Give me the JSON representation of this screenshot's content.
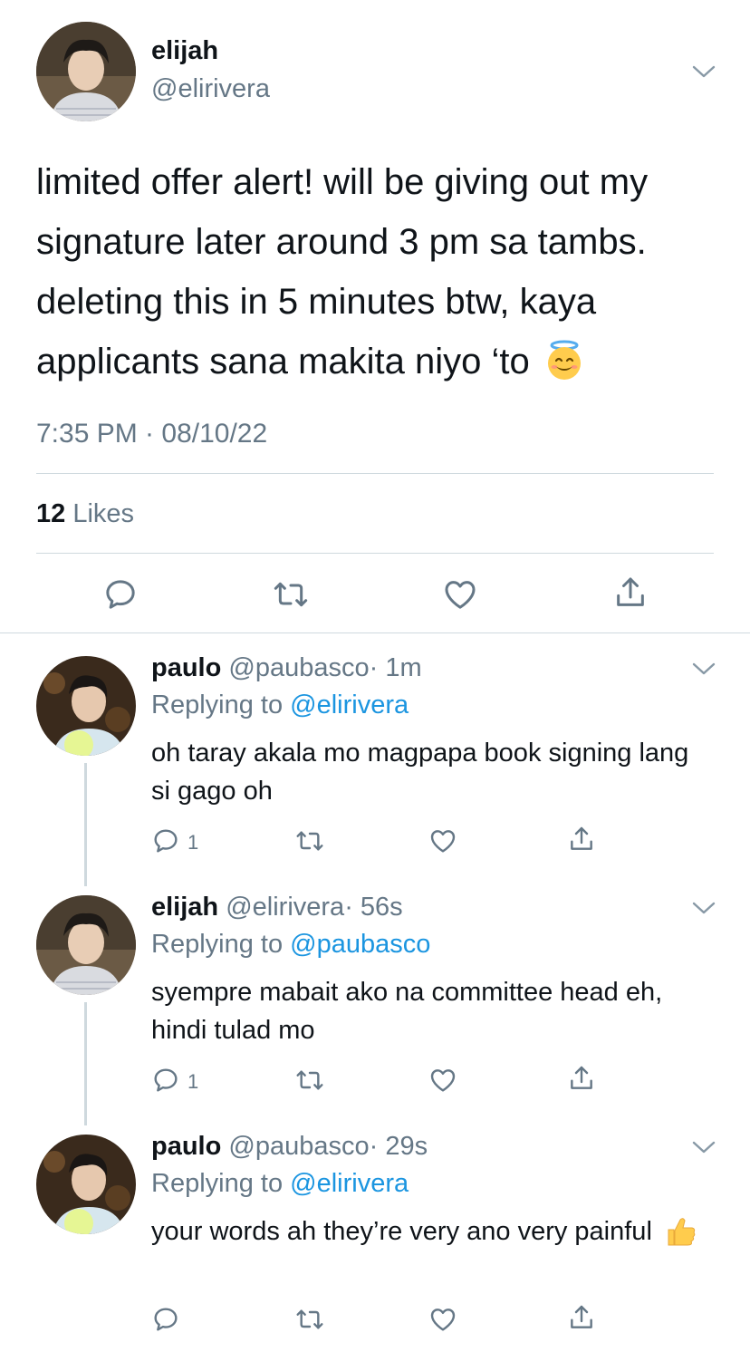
{
  "main_tweet": {
    "name": "elijah",
    "handle": "@elirivera",
    "text": "limited offer alert! will be giving out my signature later around 3 pm sa tambs. deleting this in 5 minutes btw, kaya applicants sana makita niyo ‘to",
    "emoji": "smiling-face-with-halo",
    "timestamp": "7:35 PM · 08/10/22",
    "likes_count": "12",
    "likes_label": "Likes"
  },
  "replies": [
    {
      "name": "paulo",
      "handle": "@paubasco",
      "time": "· 1m",
      "replying_prefix": "Replying to",
      "replying_to": "@elirivera",
      "text": "oh taray akala mo magpapa book signing lang si gago oh",
      "reply_count": "1"
    },
    {
      "name": "elijah",
      "handle": "@elirivera",
      "time": "· 56s",
      "replying_prefix": "Replying to",
      "replying_to": "@paubasco",
      "text": "syempre mabait ako na committee head eh, hindi tulad mo",
      "reply_count": "1"
    },
    {
      "name": "paulo",
      "handle": "@paubasco",
      "time": "· 29s",
      "replying_prefix": "Replying to",
      "replying_to": "@elirivera",
      "text": "your words ah they’re very ano very painful",
      "emoji": "thumbs-up",
      "reply_count": ""
    }
  ],
  "colors": {
    "text": "#0f1419",
    "muted": "#657786",
    "link": "#1b95e0",
    "divider": "#cfd9de"
  }
}
